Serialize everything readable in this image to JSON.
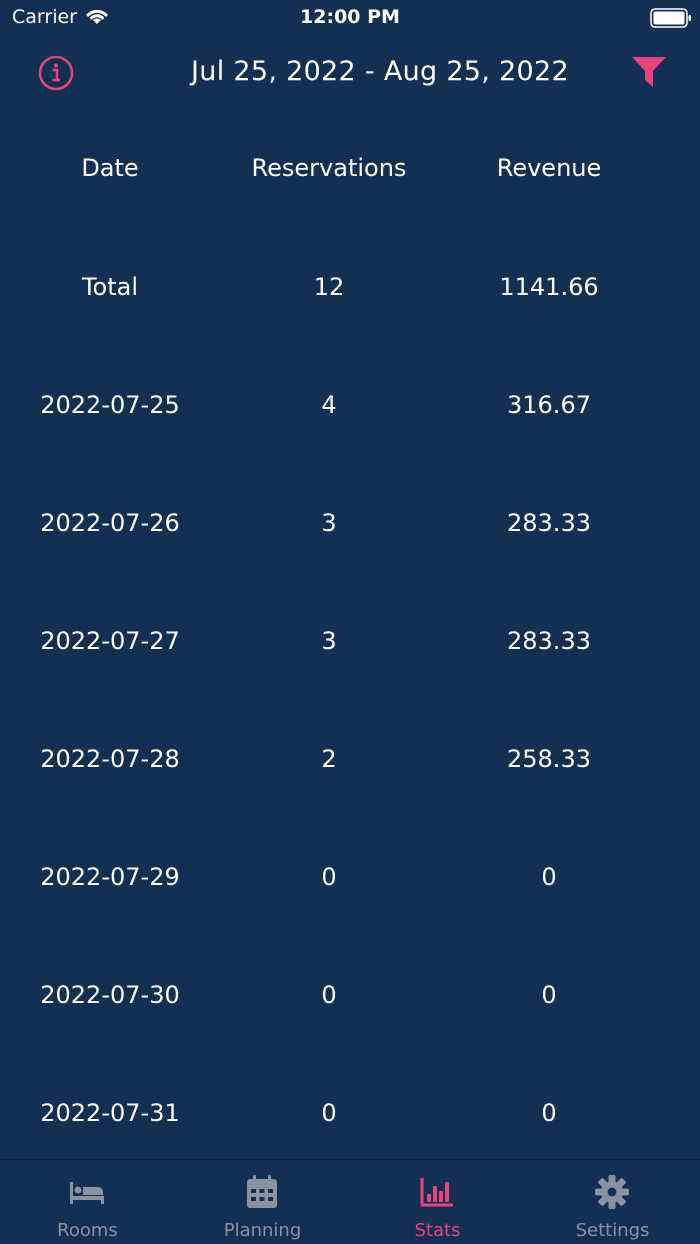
{
  "status": {
    "carrier": "Carrier",
    "time": "12:00 PM"
  },
  "nav": {
    "title": "Jul 25, 2022 - Aug 25, 2022",
    "accent": "#e8437b"
  },
  "table": {
    "headers": [
      "Date",
      "Reservations",
      "Revenue"
    ],
    "rows": [
      [
        "Total",
        "12",
        "1141.66"
      ],
      [
        "2022-07-25",
        "4",
        "316.67"
      ],
      [
        "2022-07-26",
        "3",
        "283.33"
      ],
      [
        "2022-07-27",
        "3",
        "283.33"
      ],
      [
        "2022-07-28",
        "2",
        "258.33"
      ],
      [
        "2022-07-29",
        "0",
        "0"
      ],
      [
        "2022-07-30",
        "0",
        "0"
      ],
      [
        "2022-07-31",
        "0",
        "0"
      ]
    ]
  },
  "tabs": [
    {
      "label": "Rooms",
      "icon": "bed-icon",
      "active": false
    },
    {
      "label": "Planning",
      "icon": "calendar-icon",
      "active": false
    },
    {
      "label": "Stats",
      "icon": "chart-icon",
      "active": true
    },
    {
      "label": "Settings",
      "icon": "gear-icon",
      "active": false
    }
  ]
}
